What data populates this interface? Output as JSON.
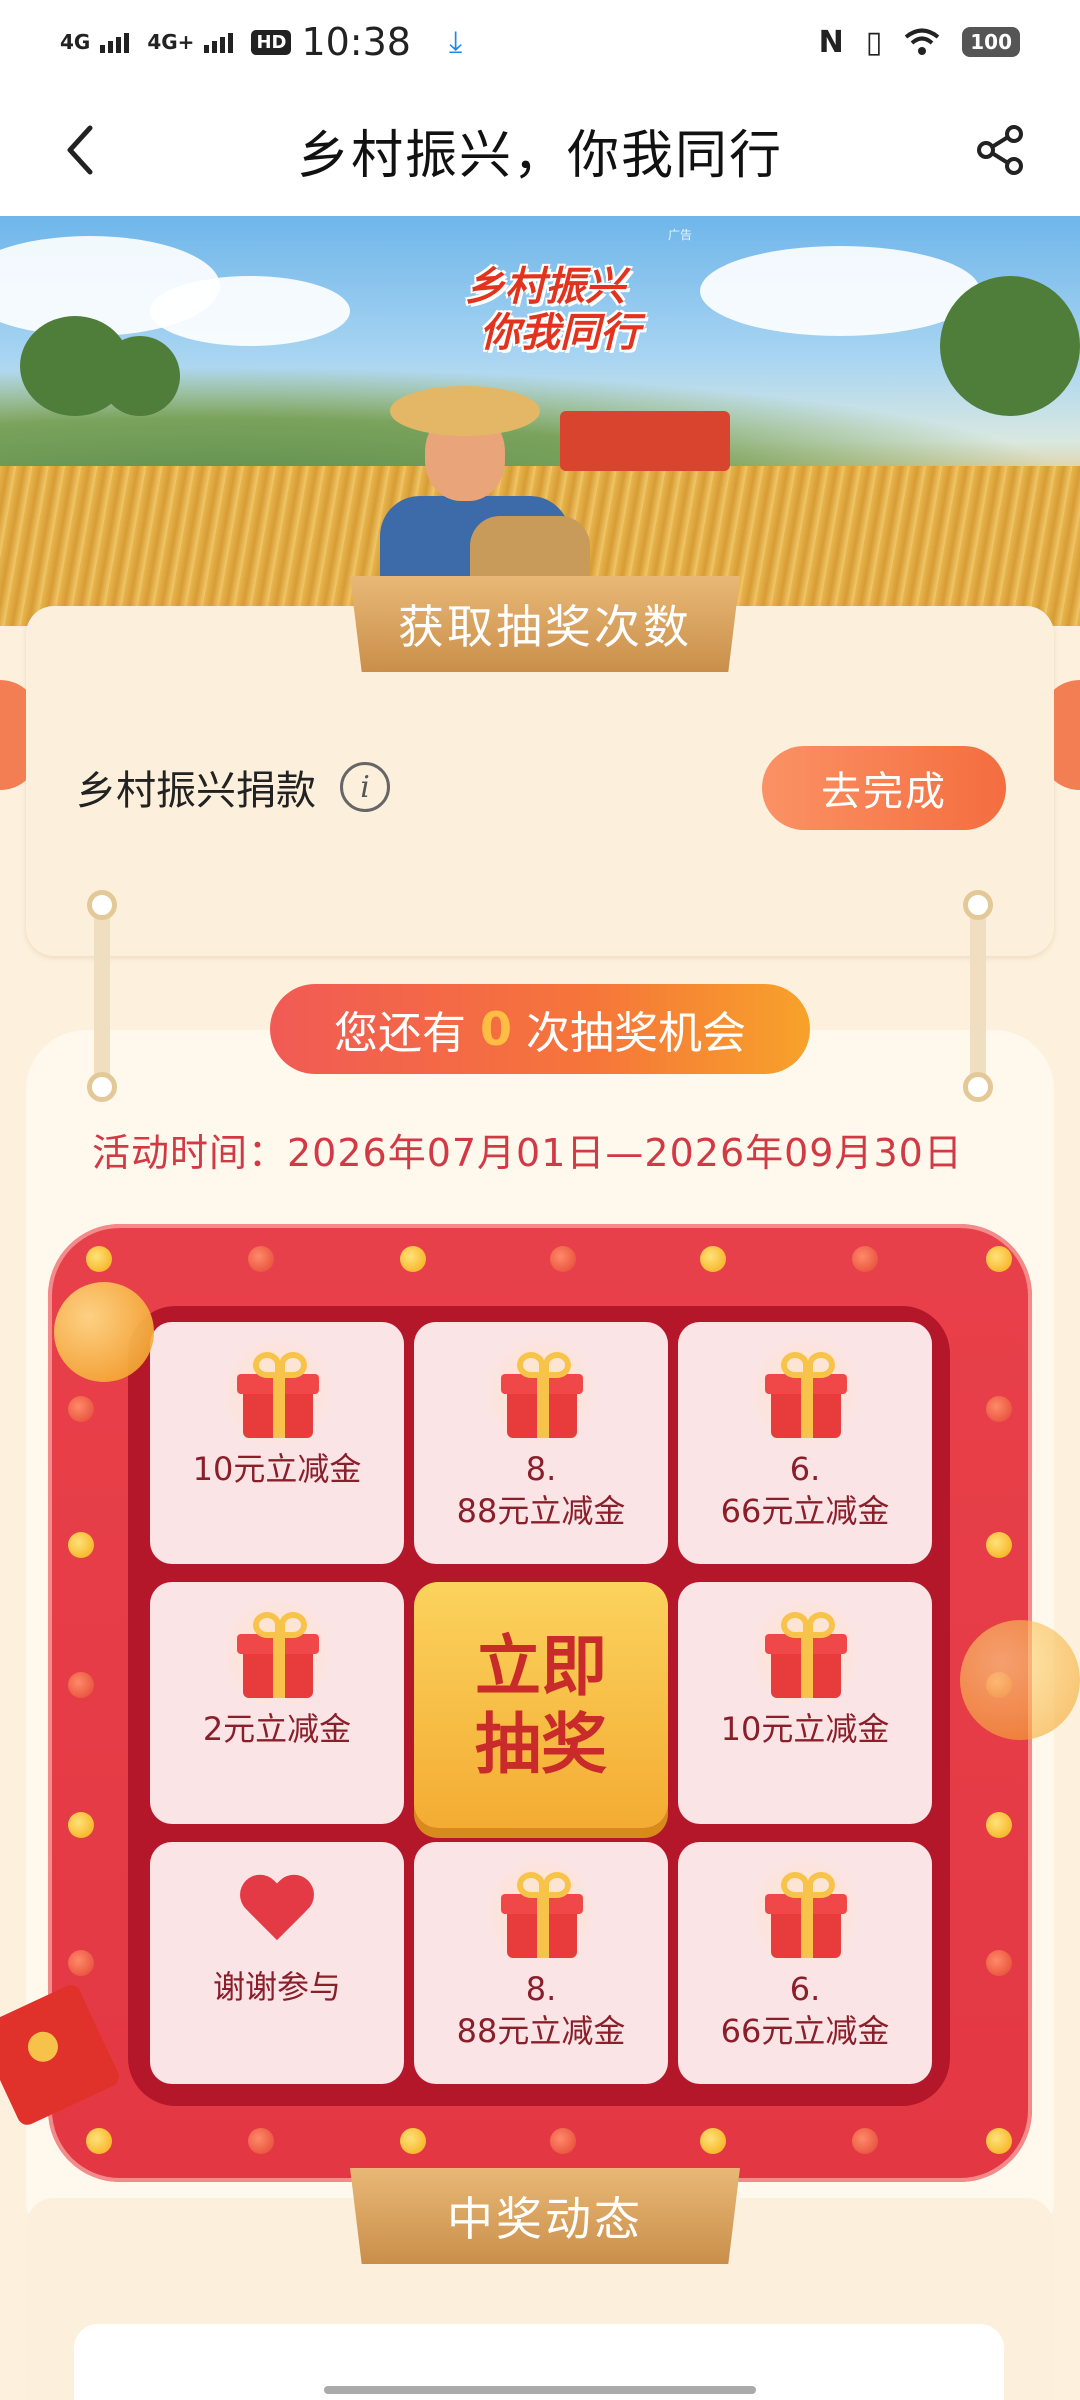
{
  "status_bar": {
    "network1": "4G",
    "network2": "4G+",
    "hd": "HD",
    "time": "10:38",
    "battery": "100"
  },
  "nav": {
    "title": "乡村振兴，你我同行"
  },
  "banner": {
    "ad_tag": "广告",
    "title_line1": "乡村振兴",
    "title_line2": "你我同行"
  },
  "task_section": {
    "ribbon": "获取抽奖次数",
    "task_label": "乡村振兴捐款",
    "info_glyph": "i",
    "task_button": "去完成"
  },
  "draw_section": {
    "chances_prefix": "您还有",
    "chances_count": "0",
    "chances_suffix": "次抽奖机会",
    "activity_time": "活动时间：2026年07月01日—2026年09月30日",
    "draw_button_line1": "立即",
    "draw_button_line2": "抽奖",
    "prizes": [
      {
        "label": "10元立减金",
        "icon": "gift-icon"
      },
      {
        "label": "8.\n88元立减金",
        "icon": "gift-icon"
      },
      {
        "label": "6.\n66元立减金",
        "icon": "gift-icon"
      },
      {
        "label": "2元立减金",
        "icon": "gift-icon"
      },
      {
        "label": "10元立减金",
        "icon": "gift-icon"
      },
      {
        "label": "谢谢参与",
        "icon": "heart-icon"
      },
      {
        "label": "8.\n88元立减金",
        "icon": "gift-icon"
      },
      {
        "label": "6.\n66元立减金",
        "icon": "gift-icon"
      }
    ]
  },
  "winners_section": {
    "ribbon": "中奖动态"
  },
  "colors": {
    "accent_orange": "#f46d3f",
    "frame_red": "#e33844",
    "inner_red": "#b4162a",
    "gold": "#f4ac33"
  }
}
